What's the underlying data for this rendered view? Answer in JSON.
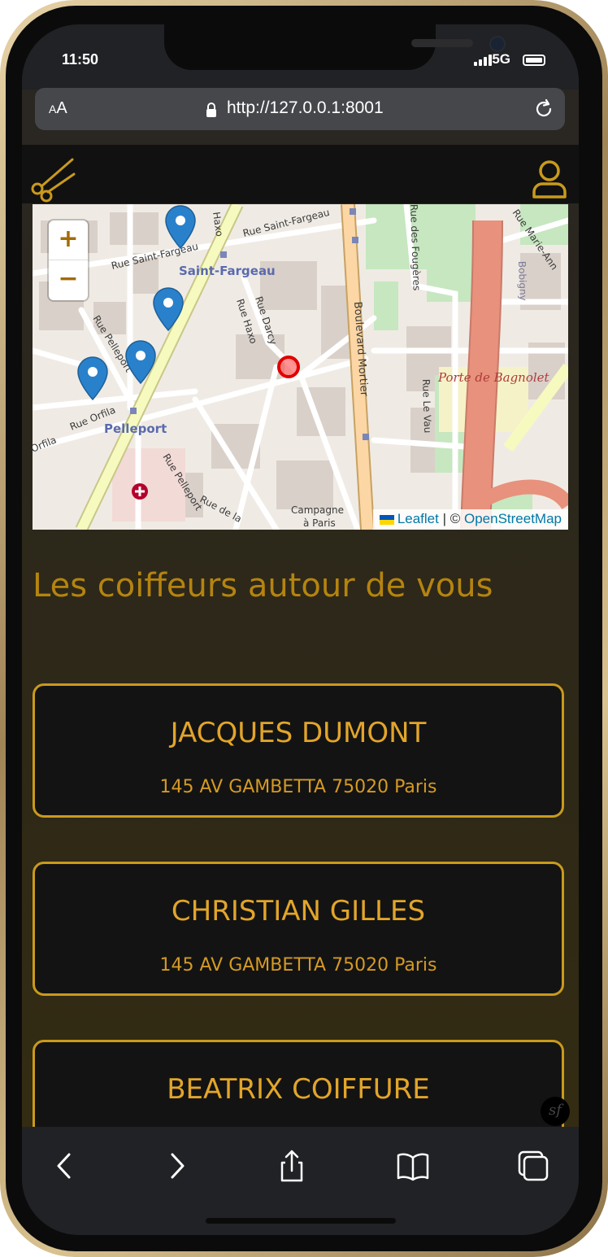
{
  "status_bar": {
    "time": "11:50",
    "network": "5G"
  },
  "browser": {
    "text_size_label": "AA",
    "url": "http://127.0.0.1:8001"
  },
  "map": {
    "zoom_in_label": "+",
    "zoom_out_label": "−",
    "attribution": {
      "leaflet": "Leaflet",
      "separator": " | © ",
      "osm": "OpenStreetMap"
    },
    "labels": {
      "saint_fargeau": "Saint-Fargeau",
      "pelleport": "Pelleport",
      "porte_de_bagnolet": "Porte de Bagnolet",
      "rue_saint_fargeau": "Rue Saint-Fargeau",
      "rue_saint_fargeau_2": "Rue Saint-Fargeau",
      "boulevard_mortier": "Boulevard Mortier",
      "rue_darcy": "Rue Darcy",
      "rue_haxo": "Rue Haxo",
      "rue_haxo_2": "Haxo",
      "rue_pelleport": "Rue Pelleport",
      "rue_pelleport_2": "Rue Pelleport",
      "rue_orfila": "Rue Orfila",
      "rue_orfila_2": "Orfila",
      "rue_le_vau": "Rue Le Vau",
      "rue_des_fougeres": "Rue des Fougères",
      "rue_marie_anne": "Rue Marie-Ann",
      "bobigny": "Bobigny",
      "rue_de_la": "Rue de la",
      "campagne": "Campagne",
      "a_paris": "à Paris"
    },
    "colors": {
      "marker": "#2a81cb",
      "user_position": "#ff0000",
      "motorway": "#e8917c",
      "trunk": "#f7fabf"
    }
  },
  "page": {
    "heading": "Les coiffeurs autour de vous",
    "barbers": [
      {
        "name": "JACQUES DUMONT",
        "address": "145 AV GAMBETTA 75020 Paris"
      },
      {
        "name": "CHRISTIAN GILLES",
        "address": "145 AV GAMBETTA 75020 Paris"
      },
      {
        "name": "BEATRIX COIFFURE",
        "address": ""
      }
    ],
    "accent_color": "#c99a1c",
    "symfony_badge": "sf"
  },
  "icons": {
    "logo": "scissors-icon",
    "account": "user-icon",
    "lock": "lock-icon",
    "reload": "reload-icon",
    "toolbar": [
      "back-icon",
      "forward-icon",
      "share-icon",
      "bookmarks-icon",
      "tabs-icon"
    ]
  }
}
